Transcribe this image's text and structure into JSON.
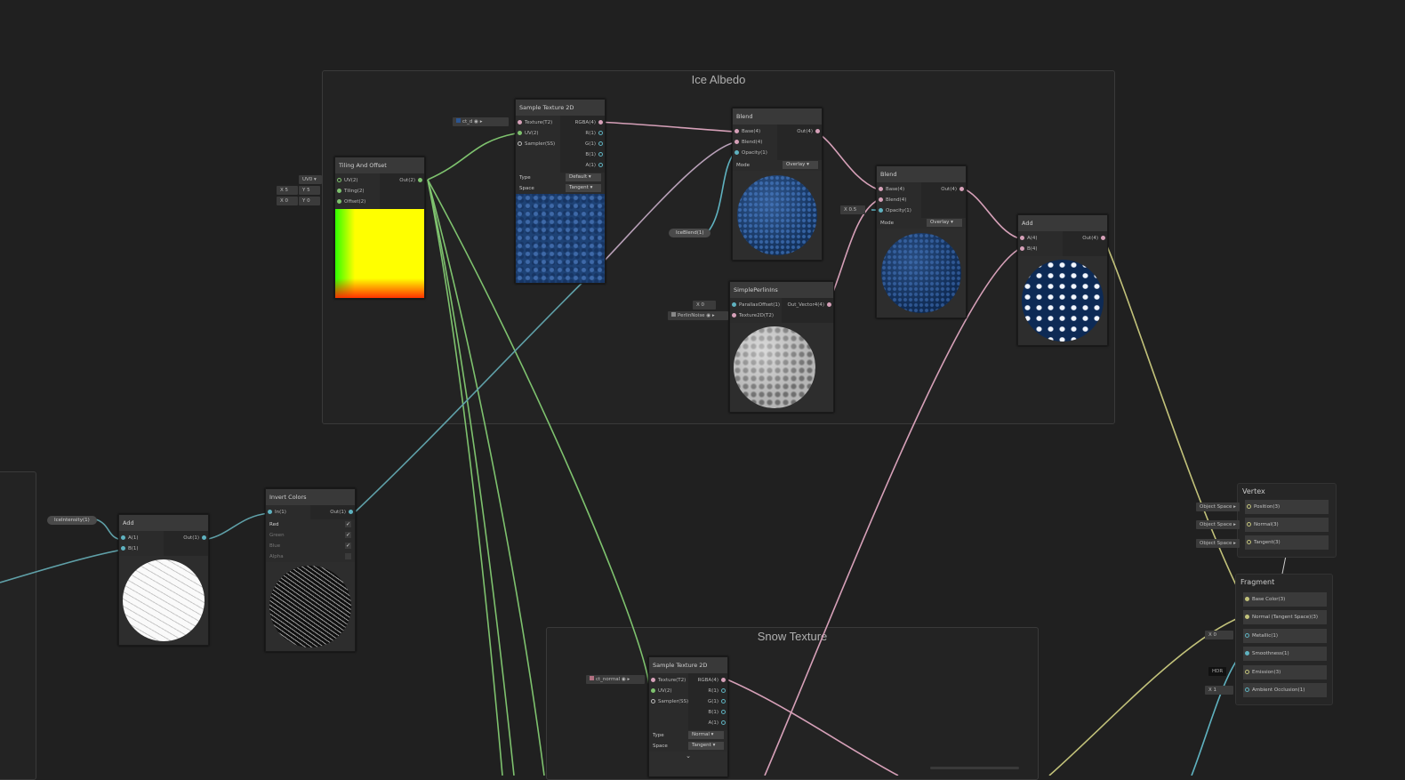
{
  "groups": {
    "ice_albedo": "Ice Albedo",
    "snow_texture": "Snow Texture"
  },
  "tiling_offset": {
    "title": "Tiling And Offset",
    "in": [
      "UV(2)",
      "Tiling(2)",
      "Offset(2)"
    ],
    "out": [
      "Out(2)"
    ],
    "uv": "UV0",
    "tiling_x": "5",
    "tiling_y": "5",
    "offset_x": "0",
    "offset_y": "0",
    "x": "X",
    "y": "Y"
  },
  "sample_1": {
    "title": "Sample Texture 2D",
    "in": [
      "Texture(T2)",
      "UV(2)",
      "Sampler(SS)"
    ],
    "out": [
      "RGBA(4)",
      "R(1)",
      "G(1)",
      "B(1)",
      "A(1)"
    ],
    "type_label": "Type",
    "type_value": "Default",
    "space_label": "Space",
    "space_value": "Tangent",
    "texture": "ct_d"
  },
  "blend_1": {
    "title": "Blend",
    "in": [
      "Base(4)",
      "Blend(4)",
      "Opacity(1)"
    ],
    "out": [
      "Out(4)"
    ],
    "mode_label": "Mode",
    "mode_value": "Overlay"
  },
  "ice_blend_prop": "IceBlend(1)",
  "simple_perlin": {
    "title": "SimplePerlinIns",
    "in": [
      "ParallaxOffset(1)",
      "Texture2D(T2)"
    ],
    "out": [
      "Out_Vector4(4)"
    ],
    "x": "X",
    "x_value": "0",
    "texture": "PerlinNoise"
  },
  "blend_2": {
    "title": "Blend",
    "in": [
      "Base(4)",
      "Blend(4)",
      "Opacity(1)"
    ],
    "out": [
      "Out(4)"
    ],
    "mode_label": "Mode",
    "mode_value": "Overlay",
    "x": "X",
    "opacity": "0.5"
  },
  "add_1": {
    "title": "Add",
    "in": [
      "A(4)",
      "B(4)"
    ],
    "out": [
      "Out(4)"
    ]
  },
  "invert": {
    "title": "Invert Colors",
    "in": [
      "In(1)"
    ],
    "out": [
      "Out(1)"
    ],
    "channels": [
      {
        "label": "Red",
        "checked": "✓"
      },
      {
        "label": "Green",
        "checked": "✓"
      },
      {
        "label": "Blue",
        "checked": "✓"
      },
      {
        "label": "Alpha",
        "checked": ""
      }
    ]
  },
  "add_2": {
    "title": "Add",
    "in": [
      "A(1)",
      "B(1)"
    ],
    "out": [
      "Out(1)"
    ]
  },
  "ice_intensity": "IceIntensity(1)",
  "sample_2": {
    "title": "Sample Texture 2D",
    "in": [
      "Texture(T2)",
      "UV(2)",
      "Sampler(SS)"
    ],
    "out": [
      "RGBA(4)",
      "R(1)",
      "G(1)",
      "B(1)",
      "A(1)"
    ],
    "type_label": "Type",
    "type_value": "Normal",
    "space_label": "Space",
    "space_value": "Tangent",
    "texture": "ct_normal"
  },
  "vertex": {
    "title": "Vertex",
    "blocks": [
      "Position(3)",
      "Normal(3)",
      "Tangent(3)"
    ],
    "space": "Object Space"
  },
  "fragment": {
    "title": "Fragment",
    "blocks": [
      "Base Color(3)",
      "Normal (Tangent Space)(3)",
      "Metallic(1)",
      "Smoothness(1)",
      "Emission(3)",
      "Ambient Occlusion(1)"
    ],
    "metallic_x": "X",
    "metallic_value": "0",
    "emission_hdr": "HDR",
    "ao_x": "X",
    "ao_value": "1"
  }
}
